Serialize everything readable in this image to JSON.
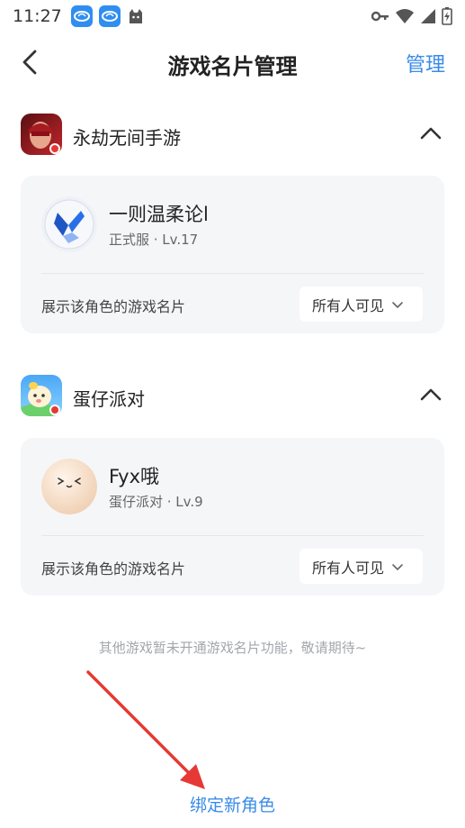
{
  "status_bar": {
    "time": "11:27",
    "app_badges": [
      "badge-app-1",
      "badge-app-2"
    ],
    "icons": [
      "cat-icon",
      "key-icon",
      "wifi-icon",
      "signal-icon",
      "battery-icon"
    ]
  },
  "header": {
    "title": "游戏名片管理",
    "manage_label": "管理"
  },
  "games": [
    {
      "name": "永劫无间手游",
      "role": {
        "name": "一则温柔论l",
        "meta": "正式服 · Lv.17"
      },
      "show_label": "展示该角色的游戏名片",
      "visibility": "所有人可见"
    },
    {
      "name": "蛋仔派对",
      "role": {
        "name": "Fyx哦",
        "meta": "蛋仔派对 · Lv.9"
      },
      "show_label": "展示该角色的游戏名片",
      "visibility": "所有人可见"
    }
  ],
  "footer_note": "其他游戏暂未开通游戏名片功能，敬请期待~",
  "bind_button": "绑定新角色",
  "colors": {
    "accent": "#3a8be8",
    "card_bg": "#f5f6f8",
    "annotation_red": "#e53935"
  }
}
